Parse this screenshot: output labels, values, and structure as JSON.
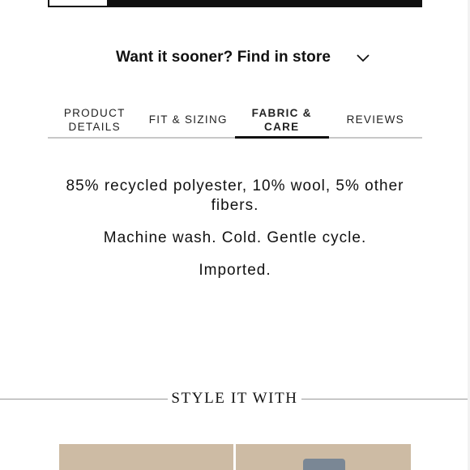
{
  "find_in_store": {
    "label": "Want it sooner? Find in store",
    "icon": "chevron-down-icon"
  },
  "tabs": [
    {
      "line1": "PRODUCT",
      "line2": "DETAILS",
      "active": false
    },
    {
      "line1": "FIT & SIZING",
      "line2": "",
      "active": false
    },
    {
      "line1": "FABRIC &",
      "line2": "CARE",
      "active": true
    },
    {
      "line1": "REVIEWS",
      "line2": "",
      "active": false
    }
  ],
  "fabric_care": {
    "composition": "85% recycled polyester, 10% wool, 5% other fibers.",
    "care": "Machine wash. Cold. Gentle cycle.",
    "origin": "Imported."
  },
  "style_it_with": {
    "title": "STYLE IT WITH"
  },
  "colors": {
    "text": "#111111",
    "tab_border": "#c8c8c8",
    "divider": "#999999",
    "tile_bg": "#cdbba4"
  }
}
